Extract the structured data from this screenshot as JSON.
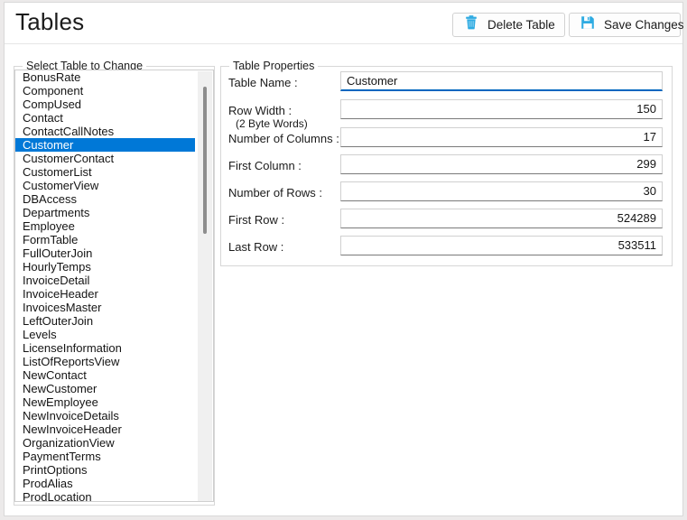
{
  "window": {
    "title": "Tables"
  },
  "toolbar": {
    "delete_table_label": "Delete Table",
    "delete_table_icon": "trash-icon",
    "save_changes_label": "Save Changes",
    "save_changes_icon": "floppy-disk-save-icon"
  },
  "select_table_group": {
    "label": "Select Table to Change",
    "selected_item": "Customer",
    "items": [
      "BonusRate",
      "Component",
      "CompUsed",
      "Contact",
      "ContactCallNotes",
      "Customer",
      "CustomerContact",
      "CustomerList",
      "CustomerView",
      "DBAccess",
      "Departments",
      "Employee",
      "FormTable",
      "FullOuterJoin",
      "HourlyTemps",
      "InvoiceDetail",
      "InvoiceHeader",
      "InvoicesMaster",
      "LeftOuterJoin",
      "Levels",
      "LicenseInformation",
      "ListOfReportsView",
      "NewContact",
      "NewCustomer",
      "NewEmployee",
      "NewInvoiceDetails",
      "NewInvoiceHeader",
      "OrganizationView",
      "PaymentTerms",
      "PrintOptions",
      "ProdAlias",
      "ProdLocation"
    ]
  },
  "table_properties": {
    "label": "Table Properties",
    "fields": {
      "table_name": {
        "label": "Table Name :",
        "value": "Customer"
      },
      "row_width": {
        "label": "Row Width :",
        "sublabel": "(2 Byte Words)",
        "value": "150"
      },
      "number_of_columns": {
        "label": "Number of Columns :",
        "value": "17"
      },
      "first_column": {
        "label": "First Column :",
        "value": "299"
      },
      "number_of_rows": {
        "label": "Number of Rows :",
        "value": "30"
      },
      "first_row": {
        "label": "First Row :",
        "value": "524289"
      },
      "last_row": {
        "label": "Last Row :",
        "value": "533511"
      }
    }
  },
  "colors": {
    "accent": "#0078d7",
    "focus_underline": "#0067c0",
    "icon_blue": "#2eabe2",
    "window_bg": "#ffffff",
    "desktop_bg": "#eceaea"
  }
}
